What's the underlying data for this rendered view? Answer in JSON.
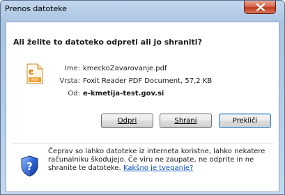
{
  "window": {
    "title": "Prenos datoteke"
  },
  "dialog": {
    "question": "Ali želite to datoteko odpreti ali jo shraniti?",
    "file": {
      "name_label": "Ime:",
      "name_value": "kmeckoZavarovanje.pdf",
      "type_label": "Vrsta:",
      "type_value": "Foxit Reader PDF Document, 57,2 KB",
      "from_label": "Od:",
      "from_value": "e-kmetija-test.gov.si",
      "icon": "pdf-file-icon"
    },
    "buttons": {
      "open": "Odpri",
      "save": "Shrani",
      "cancel": "Prekliči"
    },
    "warning": {
      "text": "Čeprav so lahko datoteke iz interneta koristne, lahko nekatere računalniku škodujejo. Če viru ne zaupate, ne odprite in ne shranite te datoteke. ",
      "link": "Kakšno je tveganje?",
      "icon": "shield-question-icon"
    }
  }
}
